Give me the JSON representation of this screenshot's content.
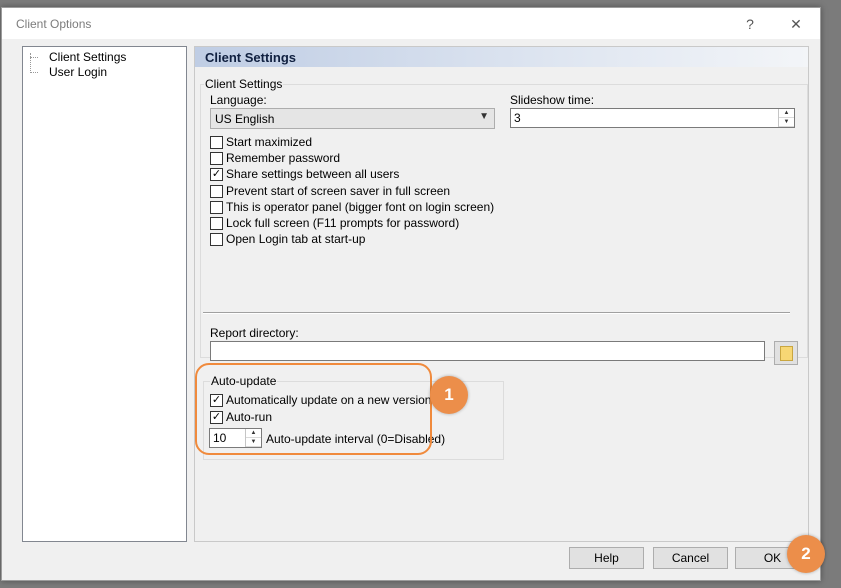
{
  "window": {
    "title": "Client Options",
    "help_glyph": "?",
    "close_glyph": "✕"
  },
  "tree": {
    "items": [
      {
        "label": "Client Settings"
      },
      {
        "label": "User Login"
      }
    ]
  },
  "panel": {
    "header": "Client Settings",
    "group_title": "Client Settings",
    "language": {
      "label": "Language:",
      "value": "US English"
    },
    "slideshow": {
      "label": "Slideshow time:",
      "value": "3"
    },
    "checkboxes": [
      {
        "label": "Start maximized",
        "checked": false
      },
      {
        "label": "Remember password",
        "checked": false
      },
      {
        "label": "Share settings between all users",
        "checked": true
      },
      {
        "label": "Prevent start of screen saver in full screen",
        "checked": false
      },
      {
        "label": "This is operator panel (bigger font on login screen)",
        "checked": false
      },
      {
        "label": "Lock full screen (F11 prompts for password)",
        "checked": false
      },
      {
        "label": "Open Login tab at start-up",
        "checked": false
      }
    ],
    "report_directory": {
      "label": "Report directory:",
      "value": ""
    },
    "autoupdate": {
      "title": "Auto-update",
      "auto_update": {
        "label": "Automatically update on a new version",
        "checked": true
      },
      "auto_run": {
        "label": "Auto-run",
        "checked": true
      },
      "interval": {
        "value": "10",
        "label": "Auto-update interval (0=Disabled)"
      }
    }
  },
  "buttons": {
    "help": "Help",
    "cancel": "Cancel",
    "ok": "OK"
  },
  "annotations": {
    "badge1": "1",
    "badge2": "2",
    "accent": "#ec8e4a"
  }
}
